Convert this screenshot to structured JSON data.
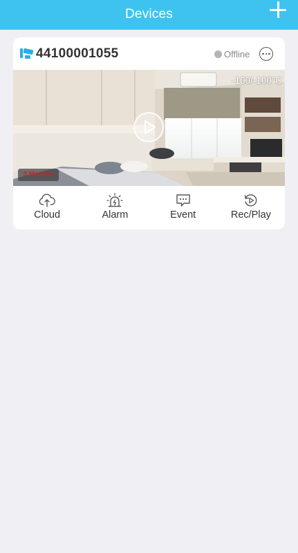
{
  "header": {
    "title": "Devices"
  },
  "device": {
    "id": "44100001055",
    "status": "Offline",
    "temperature": "-100/-100°C",
    "rec_badge": "3 Months"
  },
  "actions": [
    {
      "label": "Cloud",
      "icon": "cloud-upload-icon"
    },
    {
      "label": "Alarm",
      "icon": "alarm-siren-icon"
    },
    {
      "label": "Event",
      "icon": "event-message-icon"
    },
    {
      "label": "Rec/Play",
      "icon": "replay-icon"
    }
  ],
  "colors": {
    "header": "#3ec3f0",
    "background": "#efeff4",
    "card": "#ffffff",
    "status_dot": "#b5b5b5",
    "brand_icon": "#2aaee6"
  }
}
